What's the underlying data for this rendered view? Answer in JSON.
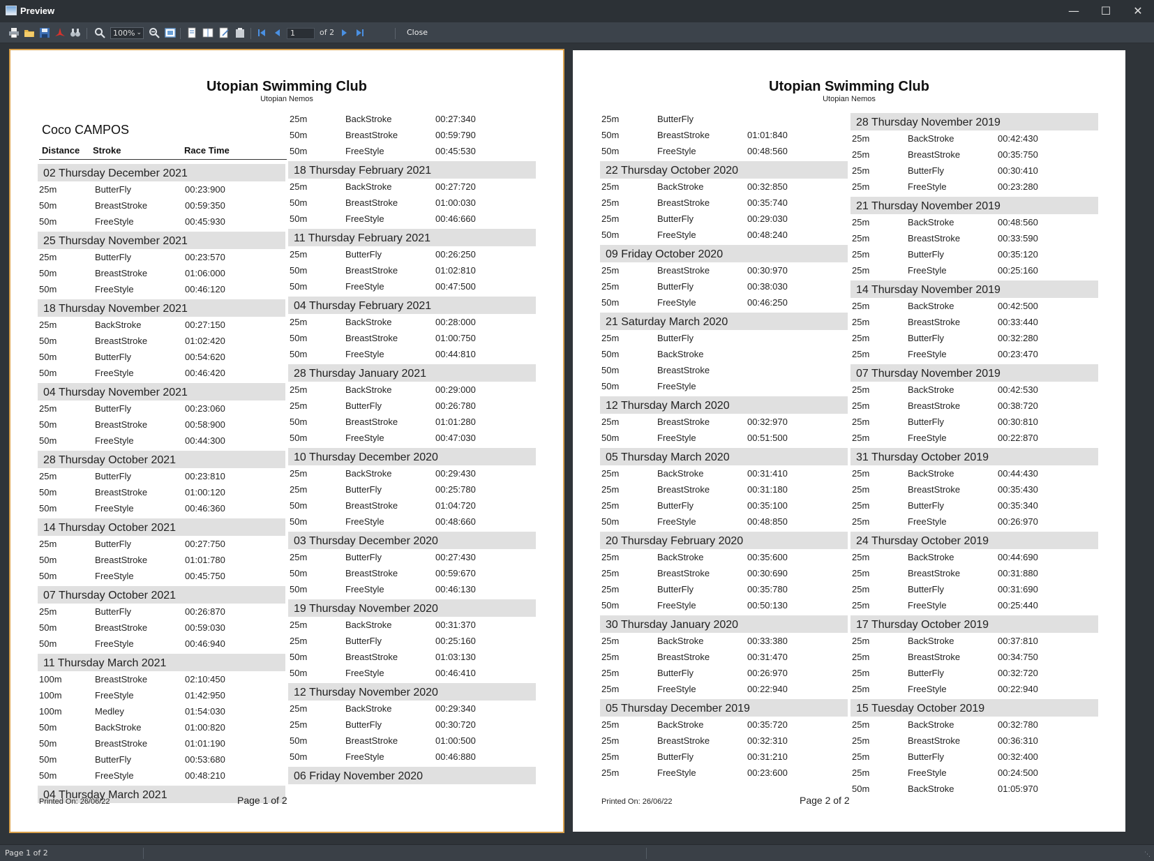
{
  "window": {
    "title": "Preview"
  },
  "toolbar": {
    "zoom": "100%",
    "page_value": "1",
    "page_of": "of 2",
    "close_label": "Close"
  },
  "status": {
    "text": "Page 1 of 2"
  },
  "report": {
    "club_name": "Utopian Swimming Club",
    "club_sub": "Utopian Nemos",
    "swimmer": "Coco CAMPOS",
    "headers": {
      "distance": "Distance",
      "stroke": "Stroke",
      "race_time": "Race Time"
    }
  },
  "pages": [
    {
      "printed": "Printed On: 26/06/22",
      "page_label": "Page 1 of 2",
      "columns": [
        [
          {
            "date": "02 Thursday December 2021",
            "rows": [
              [
                "25m",
                "ButterFly",
                "00:23:900"
              ],
              [
                "50m",
                "BreastStroke",
                "00:59:350"
              ],
              [
                "50m",
                "FreeStyle",
                "00:45:930"
              ]
            ]
          },
          {
            "date": "25 Thursday November 2021",
            "rows": [
              [
                "25m",
                "ButterFly",
                "00:23:570"
              ],
              [
                "50m",
                "BreastStroke",
                "01:06:000"
              ],
              [
                "50m",
                "FreeStyle",
                "00:46:120"
              ]
            ]
          },
          {
            "date": "18 Thursday November 2021",
            "rows": [
              [
                "25m",
                "BackStroke",
                "00:27:150"
              ],
              [
                "50m",
                "BreastStroke",
                "01:02:420"
              ],
              [
                "50m",
                "ButterFly",
                "00:54:620"
              ],
              [
                "50m",
                "FreeStyle",
                "00:46:420"
              ]
            ]
          },
          {
            "date": "04 Thursday November 2021",
            "rows": [
              [
                "25m",
                "ButterFly",
                "00:23:060"
              ],
              [
                "50m",
                "BreastStroke",
                "00:58:900"
              ],
              [
                "50m",
                "FreeStyle",
                "00:44:300"
              ]
            ]
          },
          {
            "date": "28 Thursday October 2021",
            "rows": [
              [
                "25m",
                "ButterFly",
                "00:23:810"
              ],
              [
                "50m",
                "BreastStroke",
                "01:00:120"
              ],
              [
                "50m",
                "FreeStyle",
                "00:46:360"
              ]
            ]
          },
          {
            "date": "14 Thursday October 2021",
            "rows": [
              [
                "25m",
                "ButterFly",
                "00:27:750"
              ],
              [
                "50m",
                "BreastStroke",
                "01:01:780"
              ],
              [
                "50m",
                "FreeStyle",
                "00:45:750"
              ]
            ]
          },
          {
            "date": "07 Thursday October 2021",
            "rows": [
              [
                "25m",
                "ButterFly",
                "00:26:870"
              ],
              [
                "50m",
                "BreastStroke",
                "00:59:030"
              ],
              [
                "50m",
                "FreeStyle",
                "00:46:940"
              ]
            ]
          },
          {
            "date": "11 Thursday March 2021",
            "rows": [
              [
                "100m",
                "BreastStroke",
                "02:10:450"
              ],
              [
                "100m",
                "FreeStyle",
                "01:42:950"
              ],
              [
                "100m",
                "Medley",
                "01:54:030"
              ],
              [
                "50m",
                "BackStroke",
                "01:00:820"
              ],
              [
                "50m",
                "BreastStroke",
                "01:01:190"
              ],
              [
                "50m",
                "ButterFly",
                "00:53:680"
              ],
              [
                "50m",
                "FreeStyle",
                "00:48:210"
              ]
            ]
          },
          {
            "date": "04 Thursday March 2021",
            "rows": []
          }
        ],
        [
          {
            "date": "",
            "rows": [
              [
                "25m",
                "BackStroke",
                "00:27:340"
              ],
              [
                "50m",
                "BreastStroke",
                "00:59:790"
              ],
              [
                "50m",
                "FreeStyle",
                "00:45:530"
              ]
            ]
          },
          {
            "date": "18 Thursday February 2021",
            "rows": [
              [
                "25m",
                "BackStroke",
                "00:27:720"
              ],
              [
                "50m",
                "BreastStroke",
                "01:00:030"
              ],
              [
                "50m",
                "FreeStyle",
                "00:46:660"
              ]
            ]
          },
          {
            "date": "11 Thursday February 2021",
            "rows": [
              [
                "25m",
                "ButterFly",
                "00:26:250"
              ],
              [
                "50m",
                "BreastStroke",
                "01:02:810"
              ],
              [
                "50m",
                "FreeStyle",
                "00:47:500"
              ]
            ]
          },
          {
            "date": "04 Thursday February 2021",
            "rows": [
              [
                "25m",
                "BackStroke",
                "00:28:000"
              ],
              [
                "50m",
                "BreastStroke",
                "01:00:750"
              ],
              [
                "50m",
                "FreeStyle",
                "00:44:810"
              ]
            ]
          },
          {
            "date": "28 Thursday January 2021",
            "rows": [
              [
                "25m",
                "BackStroke",
                "00:29:000"
              ],
              [
                "25m",
                "ButterFly",
                "00:26:780"
              ],
              [
                "50m",
                "BreastStroke",
                "01:01:280"
              ],
              [
                "50m",
                "FreeStyle",
                "00:47:030"
              ]
            ]
          },
          {
            "date": "10 Thursday December 2020",
            "rows": [
              [
                "25m",
                "BackStroke",
                "00:29:430"
              ],
              [
                "25m",
                "ButterFly",
                "00:25:780"
              ],
              [
                "50m",
                "BreastStroke",
                "01:04:720"
              ],
              [
                "50m",
                "FreeStyle",
                "00:48:660"
              ]
            ]
          },
          {
            "date": "03 Thursday December 2020",
            "rows": [
              [
                "25m",
                "ButterFly",
                "00:27:430"
              ],
              [
                "50m",
                "BreastStroke",
                "00:59:670"
              ],
              [
                "50m",
                "FreeStyle",
                "00:46:130"
              ]
            ]
          },
          {
            "date": "19 Thursday November 2020",
            "rows": [
              [
                "25m",
                "BackStroke",
                "00:31:370"
              ],
              [
                "25m",
                "ButterFly",
                "00:25:160"
              ],
              [
                "50m",
                "BreastStroke",
                "01:03:130"
              ],
              [
                "50m",
                "FreeStyle",
                "00:46:410"
              ]
            ]
          },
          {
            "date": "12 Thursday November 2020",
            "rows": [
              [
                "25m",
                "BackStroke",
                "00:29:340"
              ],
              [
                "25m",
                "ButterFly",
                "00:30:720"
              ],
              [
                "50m",
                "BreastStroke",
                "01:00:500"
              ],
              [
                "50m",
                "FreeStyle",
                "00:46:880"
              ]
            ]
          },
          {
            "date": "06 Friday November 2020",
            "rows": []
          }
        ]
      ]
    },
    {
      "printed": "Printed On: 26/06/22",
      "page_label": "Page 2 of 2",
      "columns": [
        [
          {
            "date": "",
            "rows": [
              [
                "25m",
                "ButterFly",
                ""
              ],
              [
                "50m",
                "BreastStroke",
                "01:01:840"
              ],
              [
                "50m",
                "FreeStyle",
                "00:48:560"
              ]
            ]
          },
          {
            "date": "22 Thursday October 2020",
            "rows": [
              [
                "25m",
                "BackStroke",
                "00:32:850"
              ],
              [
                "25m",
                "BreastStroke",
                "00:35:740"
              ],
              [
                "25m",
                "ButterFly",
                "00:29:030"
              ],
              [
                "50m",
                "FreeStyle",
                "00:48:240"
              ]
            ]
          },
          {
            "date": "09 Friday October 2020",
            "rows": [
              [
                "25m",
                "BreastStroke",
                "00:30:970"
              ],
              [
                "25m",
                "ButterFly",
                "00:38:030"
              ],
              [
                "50m",
                "FreeStyle",
                "00:46:250"
              ]
            ]
          },
          {
            "date": "21 Saturday March 2020",
            "rows": [
              [
                "25m",
                "ButterFly",
                ""
              ],
              [
                "50m",
                "BackStroke",
                ""
              ],
              [
                "50m",
                "BreastStroke",
                ""
              ],
              [
                "50m",
                "FreeStyle",
                ""
              ]
            ]
          },
          {
            "date": "12 Thursday March 2020",
            "rows": [
              [
                "25m",
                "BreastStroke",
                "00:32:970"
              ],
              [
                "50m",
                "FreeStyle",
                "00:51:500"
              ]
            ]
          },
          {
            "date": "05 Thursday March 2020",
            "rows": [
              [
                "25m",
                "BackStroke",
                "00:31:410"
              ],
              [
                "25m",
                "BreastStroke",
                "00:31:180"
              ],
              [
                "25m",
                "ButterFly",
                "00:35:100"
              ],
              [
                "50m",
                "FreeStyle",
                "00:48:850"
              ]
            ]
          },
          {
            "date": "20 Thursday February 2020",
            "rows": [
              [
                "25m",
                "BackStroke",
                "00:35:600"
              ],
              [
                "25m",
                "BreastStroke",
                "00:30:690"
              ],
              [
                "25m",
                "ButterFly",
                "00:35:780"
              ],
              [
                "50m",
                "FreeStyle",
                "00:50:130"
              ]
            ]
          },
          {
            "date": "30 Thursday January 2020",
            "rows": [
              [
                "25m",
                "BackStroke",
                "00:33:380"
              ],
              [
                "25m",
                "BreastStroke",
                "00:31:470"
              ],
              [
                "25m",
                "ButterFly",
                "00:26:970"
              ],
              [
                "25m",
                "FreeStyle",
                "00:22:940"
              ]
            ]
          },
          {
            "date": "05 Thursday December 2019",
            "rows": [
              [
                "25m",
                "BackStroke",
                "00:35:720"
              ],
              [
                "25m",
                "BreastStroke",
                "00:32:310"
              ],
              [
                "25m",
                "ButterFly",
                "00:31:210"
              ],
              [
                "25m",
                "FreeStyle",
                "00:23:600"
              ]
            ]
          }
        ],
        [
          {
            "date": "28 Thursday November 2019",
            "rows": [
              [
                "25m",
                "BackStroke",
                "00:42:430"
              ],
              [
                "25m",
                "BreastStroke",
                "00:35:750"
              ],
              [
                "25m",
                "ButterFly",
                "00:30:410"
              ],
              [
                "25m",
                "FreeStyle",
                "00:23:280"
              ]
            ]
          },
          {
            "date": "21 Thursday November 2019",
            "rows": [
              [
                "25m",
                "BackStroke",
                "00:48:560"
              ],
              [
                "25m",
                "BreastStroke",
                "00:33:590"
              ],
              [
                "25m",
                "ButterFly",
                "00:35:120"
              ],
              [
                "25m",
                "FreeStyle",
                "00:25:160"
              ]
            ]
          },
          {
            "date": "14 Thursday November 2019",
            "rows": [
              [
                "25m",
                "BackStroke",
                "00:42:500"
              ],
              [
                "25m",
                "BreastStroke",
                "00:33:440"
              ],
              [
                "25m",
                "ButterFly",
                "00:32:280"
              ],
              [
                "25m",
                "FreeStyle",
                "00:23:470"
              ]
            ]
          },
          {
            "date": "07 Thursday November 2019",
            "rows": [
              [
                "25m",
                "BackStroke",
                "00:42:530"
              ],
              [
                "25m",
                "BreastStroke",
                "00:38:720"
              ],
              [
                "25m",
                "ButterFly",
                "00:30:810"
              ],
              [
                "25m",
                "FreeStyle",
                "00:22:870"
              ]
            ]
          },
          {
            "date": "31 Thursday October 2019",
            "rows": [
              [
                "25m",
                "BackStroke",
                "00:44:430"
              ],
              [
                "25m",
                "BreastStroke",
                "00:35:430"
              ],
              [
                "25m",
                "ButterFly",
                "00:35:340"
              ],
              [
                "25m",
                "FreeStyle",
                "00:26:970"
              ]
            ]
          },
          {
            "date": "24 Thursday October 2019",
            "rows": [
              [
                "25m",
                "BackStroke",
                "00:44:690"
              ],
              [
                "25m",
                "BreastStroke",
                "00:31:880"
              ],
              [
                "25m",
                "ButterFly",
                "00:31:690"
              ],
              [
                "25m",
                "FreeStyle",
                "00:25:440"
              ]
            ]
          },
          {
            "date": "17 Thursday October 2019",
            "rows": [
              [
                "25m",
                "BackStroke",
                "00:37:810"
              ],
              [
                "25m",
                "BreastStroke",
                "00:34:750"
              ],
              [
                "25m",
                "ButterFly",
                "00:32:720"
              ],
              [
                "25m",
                "FreeStyle",
                "00:22:940"
              ]
            ]
          },
          {
            "date": "15 Tuesday October 2019",
            "rows": [
              [
                "25m",
                "BackStroke",
                "00:32:780"
              ],
              [
                "25m",
                "BreastStroke",
                "00:36:310"
              ],
              [
                "25m",
                "ButterFly",
                "00:32:400"
              ],
              [
                "25m",
                "FreeStyle",
                "00:24:500"
              ],
              [
                "50m",
                "BackStroke",
                "01:05:970"
              ]
            ]
          }
        ]
      ]
    }
  ]
}
